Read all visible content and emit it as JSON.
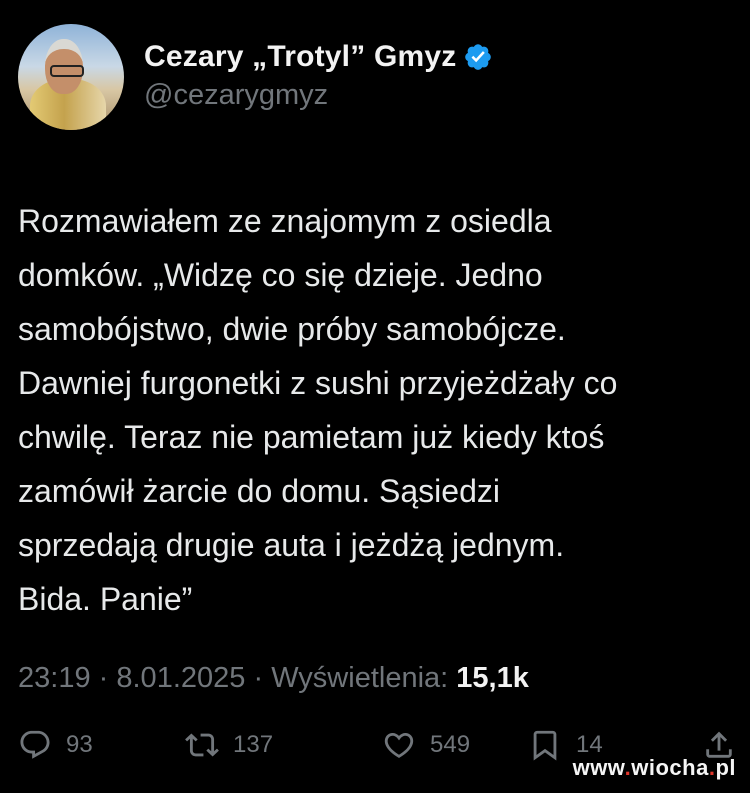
{
  "profile": {
    "display_name": "Cezary „Trotyl” Gmyz",
    "handle": "@cezarygmyz",
    "verified_color": "#1d9bf0"
  },
  "tweet": {
    "lines": [
      "Rozmawiałem ze znajomym z osiedla",
      "domków. „Widzę co się dzieje. Jedno",
      "samobójstwo, dwie próby samobójcze.",
      "Dawniej furgonetki z sushi przyjeżdżały co",
      "chwilę. Teraz nie pamietam już kiedy ktoś",
      "zamówił żarcie do domu. Sąsiedzi",
      "sprzedają drugie auta i jeżdżą jednym.",
      "Bida. Panie”"
    ]
  },
  "meta": {
    "time": "23:19",
    "date": "8.01.2025",
    "views_label": "Wyświetlenia:",
    "views_value": "15,1k",
    "separator": "·"
  },
  "actions": {
    "reply_count": "93",
    "retweet_count": "137",
    "like_count": "549",
    "bookmark_count": "14",
    "icons": [
      "reply-icon",
      "retweet-icon",
      "like-icon",
      "bookmark-icon",
      "share-icon"
    ]
  },
  "watermark": {
    "prefix": "www",
    "dot1": ".",
    "name": "wiocha",
    "dot2": ".",
    "suffix": "pl"
  }
}
